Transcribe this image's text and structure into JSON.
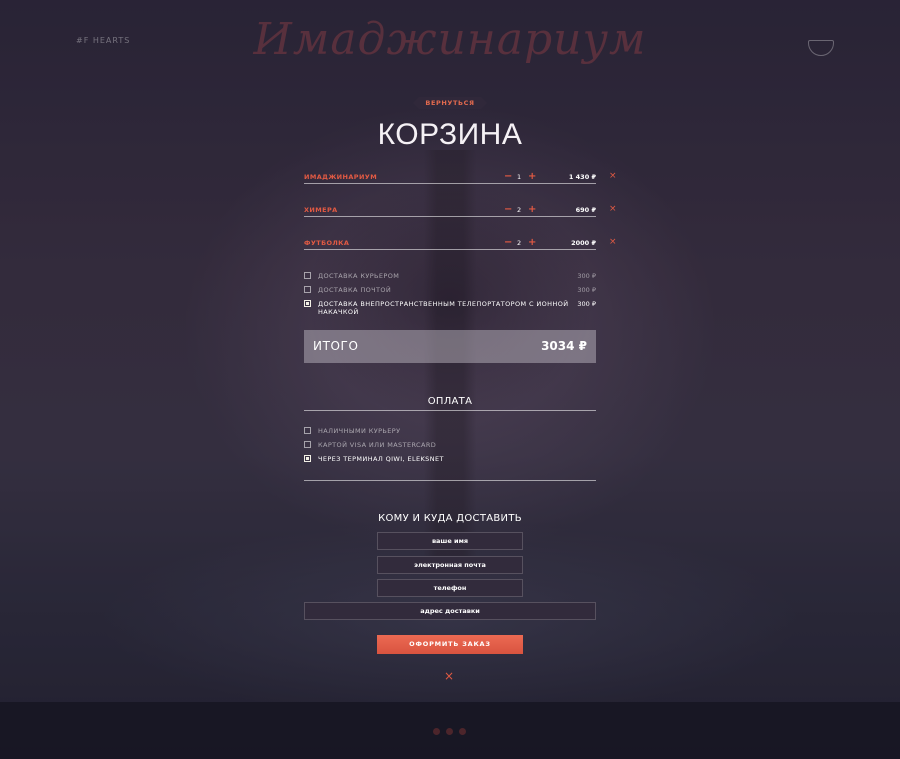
{
  "header": {
    "left_text": "#F HEARTS",
    "logo": "Имаджинариум"
  },
  "back_label": "ВЕРНУТЬСЯ",
  "title": "КОРЗИНА",
  "cart": [
    {
      "name": "ИМАДЖИНАРИУМ",
      "qty": "1",
      "price": "1 430 ₽"
    },
    {
      "name": "ХИМЕРА",
      "qty": "2",
      "price": "690 ₽"
    },
    {
      "name": "ФУТБОЛКА",
      "qty": "2",
      "price": "2000 ₽"
    }
  ],
  "qty_minus": "−",
  "qty_plus": "+",
  "remove_icon": "×",
  "delivery": [
    {
      "label": "ДОСТАВКА КУРЬЕРОМ",
      "price": "300 ₽",
      "checked": false
    },
    {
      "label": "ДОСТАВКА ПОЧТОЙ",
      "price": "300 ₽",
      "checked": false
    },
    {
      "label": "ДОСТАВКА ВНЕПРОСТРАНСТВЕННЫМ ТЕЛЕПОРТАТОРОМ С ИОННОЙ НАКАЧКОЙ",
      "price": "300 ₽",
      "checked": true
    }
  ],
  "total": {
    "label": "ИТОГО",
    "value": "3034 ₽"
  },
  "payment_title": "ОПЛАТА",
  "payment": [
    {
      "label": "НАЛИЧНЫМИ КУРЬЕРУ",
      "checked": false
    },
    {
      "label": "КАРТОЙ VISA ИЛИ MASTERCARD",
      "checked": false
    },
    {
      "label": "ЧЕРЕЗ ТЕРМИНАЛ QIWI, ELEKSNET",
      "checked": true
    }
  ],
  "delivery_form_title": "КОМУ И КУДА ДОСТАВИТЬ",
  "form": {
    "name_placeholder": "ваше имя",
    "email_placeholder": "электронная почта",
    "phone_placeholder": "телефон",
    "address_placeholder": "адрес доставки"
  },
  "submit_label": "ОФОРМИТЬ ЗАКАЗ",
  "close_icon": "×",
  "colors": {
    "accent": "#e25a43",
    "button": "#ec6a53",
    "background": "#2f2a3c"
  }
}
